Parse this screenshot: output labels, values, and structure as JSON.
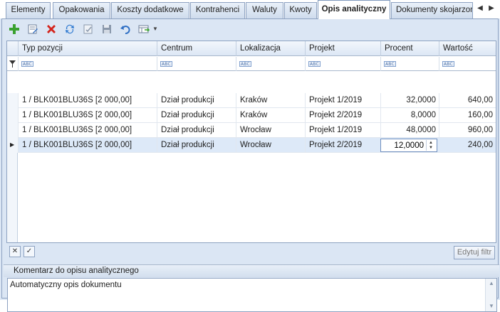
{
  "tabs": [
    {
      "label": "Elementy",
      "active": false
    },
    {
      "label": "Opakowania",
      "active": false
    },
    {
      "label": "Koszty dodatkowe",
      "active": false
    },
    {
      "label": "Kontrahenci",
      "active": false
    },
    {
      "label": "Waluty",
      "active": false
    },
    {
      "label": "Kwoty",
      "active": false
    },
    {
      "label": "Opis analityczny",
      "active": true
    },
    {
      "label": "Dokumenty skojarzone",
      "active": false
    }
  ],
  "toolbar": {
    "add_icon": "plus-icon",
    "edit_icon": "edit-document-icon",
    "delete_icon": "red-x-icon",
    "refresh_icon": "refresh-icon",
    "save_icon": "floppy-disk-icon",
    "undo_icon": "undo-arrow-icon",
    "export_icon": "export-grid-icon",
    "dropdown_icon": "chevron-down-icon"
  },
  "grid": {
    "columns": [
      "Typ pozycji",
      "Centrum",
      "Lokalizacja",
      "Projekt",
      "Procent",
      "Wartość"
    ],
    "filter_hint": "ABC",
    "rows": [
      {
        "typ": "1 / BLK001BLU36S [2 000,00]",
        "centrum": "Dział produkcji",
        "lokalizacja": "Kraków",
        "projekt": "Projekt 1/2019",
        "procent": "32,0000",
        "wartosc": "640,00"
      },
      {
        "typ": "1 / BLK001BLU36S [2 000,00]",
        "centrum": "Dział produkcji",
        "lokalizacja": "Kraków",
        "projekt": "Projekt 2/2019",
        "procent": "8,0000",
        "wartosc": "160,00"
      },
      {
        "typ": "1 / BLK001BLU36S [2 000,00]",
        "centrum": "Dział produkcji",
        "lokalizacja": "Wrocław",
        "projekt": "Projekt 1/2019",
        "procent": "48,0000",
        "wartosc": "960,00"
      },
      {
        "typ": "1 / BLK001BLU36S [2 000,00]",
        "centrum": "Dział produkcji",
        "lokalizacja": "Wrocław",
        "projekt": "Projekt 2/2019",
        "procent": "12,0000",
        "wartosc": "240,00"
      }
    ],
    "footer": {
      "edit_filter_label": "Edytuj filtr"
    }
  },
  "comment": {
    "title": "Komentarz do opisu analitycznego",
    "text": "Automatyczny opis dokumentu"
  },
  "colors": {
    "accent": "#8da2c1",
    "selected_row": "#dde9f8",
    "panel_bg": "#dbe6f4"
  }
}
